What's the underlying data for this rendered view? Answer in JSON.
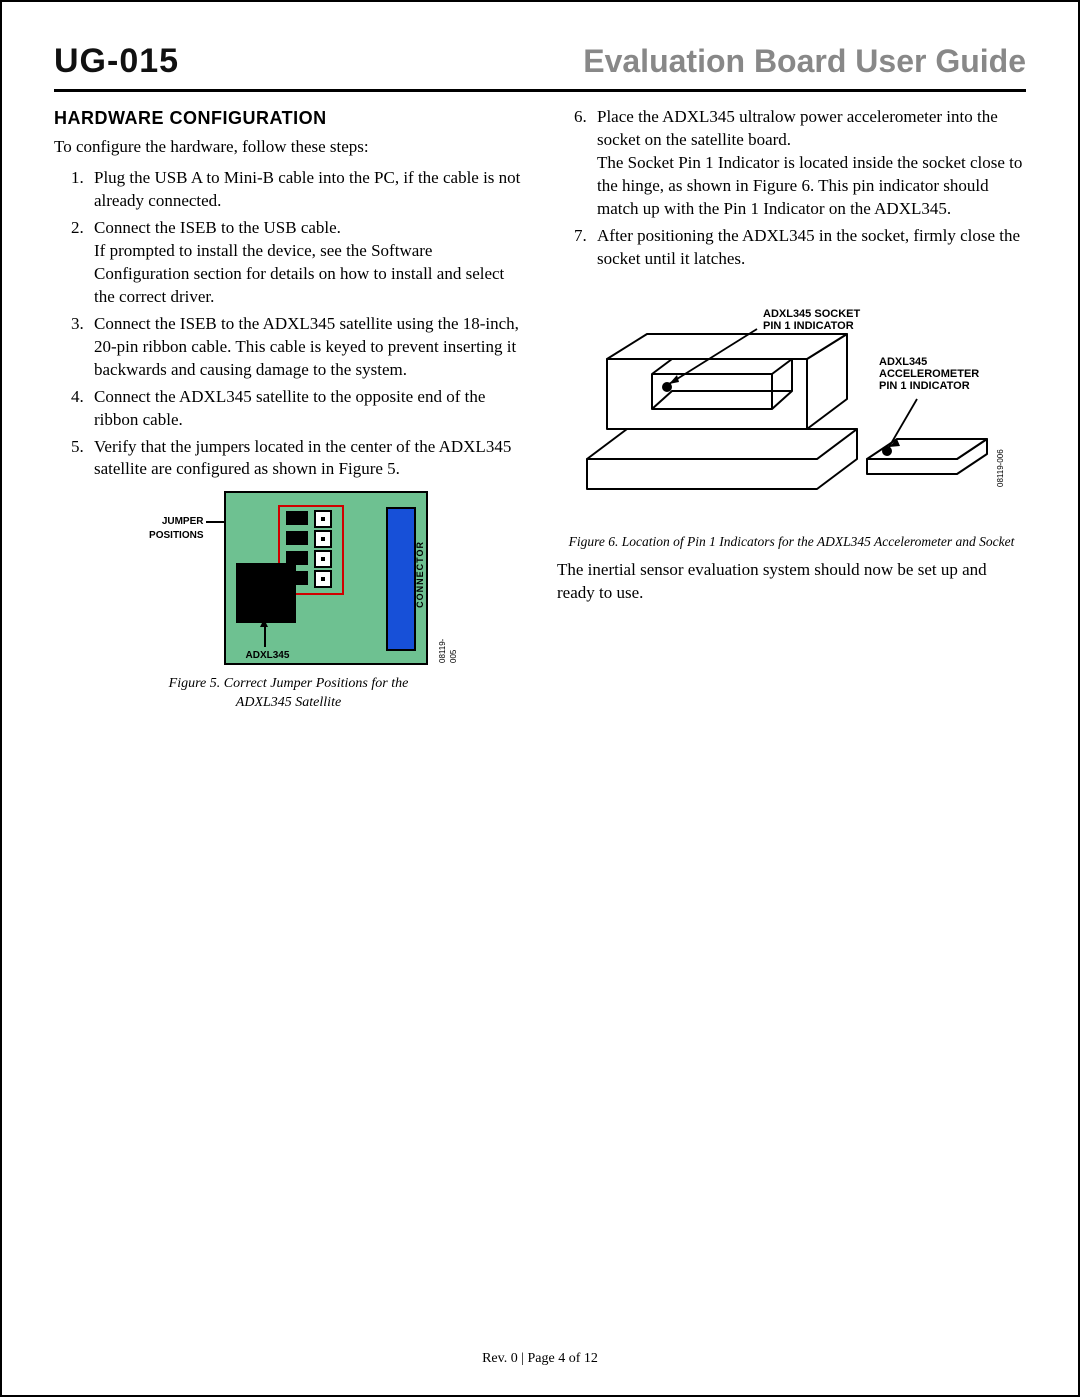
{
  "header": {
    "doc_code": "UG-015",
    "doc_title": "Evaluation Board User Guide"
  },
  "left": {
    "section_heading": "HARDWARE CONFIGURATION",
    "intro": "To configure the hardware, follow these steps:",
    "steps": [
      "Plug the USB A to Mini-B cable into the PC, if the cable is not already connected.",
      "Connect the ISEB to the USB cable.\nIf prompted to install the device, see the Software Configuration section for details on how to install and select the correct driver.",
      "Connect the ISEB to the ADXL345 satellite using the 18-inch, 20-pin ribbon cable. This cable is keyed to prevent inserting it backwards and causing damage to the system.",
      "Connect the ADXL345 satellite to the opposite end of the ribbon cable.",
      "Verify that the jumpers located in the center of the ADXL345 satellite are configured as shown in Figure 5."
    ],
    "fig5": {
      "jumper_positions_label": "JUMPER\nPOSITIONS",
      "chip_label": "ADXL345",
      "connector_label": "CONNECTOR",
      "side_code": "08119-005",
      "caption": "Figure 5. Correct Jumper Positions for the ADXL345 Satellite"
    }
  },
  "right": {
    "steps": [
      "Place the ADXL345 ultralow power accelerometer into the socket on the satellite board.\nThe Socket Pin 1 Indicator is located inside the socket close to the hinge, as shown in Figure 6. This pin indicator should match up with the Pin 1 Indicator on the ADXL345.",
      "After positioning the ADXL345 in the socket, firmly close the socket until it latches."
    ],
    "fig6": {
      "socket_label": "ADXL345 SOCKET\nPIN 1 INDICATOR",
      "accel_label": "ADXL345\nACCELEROMETER\nPIN 1 INDICATOR",
      "side_code": "08119-006",
      "caption": "Figure 6. Location of Pin 1 Indicators for the ADXL345 Accelerometer and Socket"
    },
    "closing": "The inertial sensor evaluation system should now be set up and ready to use."
  },
  "footer": "Rev. 0 | Page 4 of 12"
}
